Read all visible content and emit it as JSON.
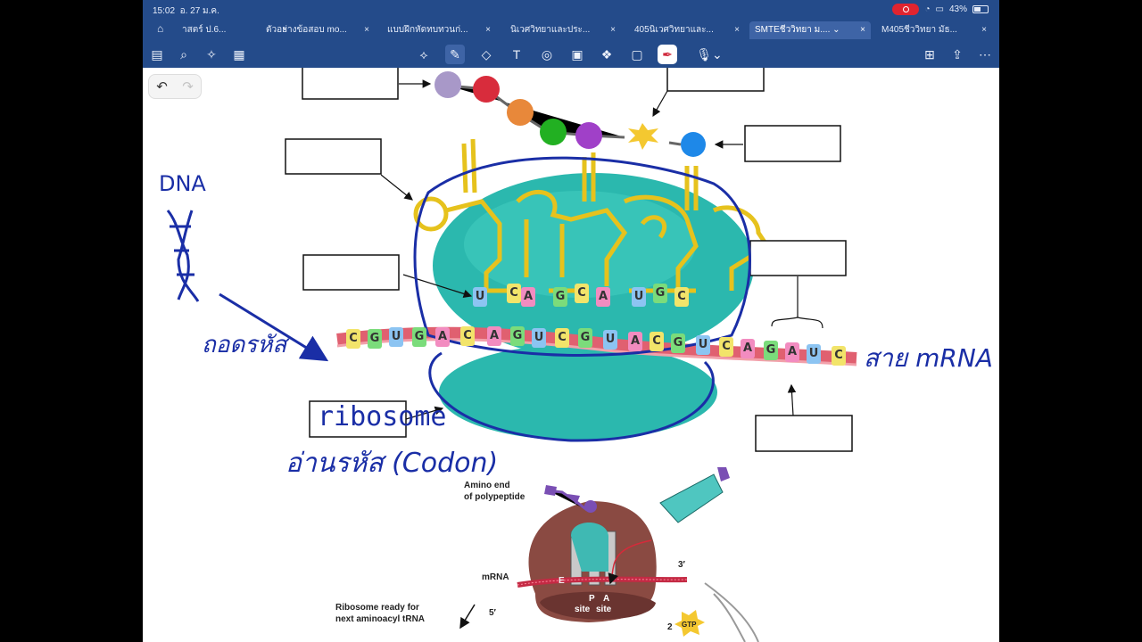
{
  "status": {
    "time": "15:02",
    "date": "อ. 27 ม.ค.",
    "battery": "43%"
  },
  "tabs": [
    {
      "label": "าสตร์ ป.6...",
      "active": false
    },
    {
      "label": "ตัวอย่างข้อสอบ mo...",
      "active": false
    },
    {
      "label": "แบบฝึกหัดทบทวนก่...",
      "active": false
    },
    {
      "label": "นิเวศวิทยาและประ...",
      "active": false
    },
    {
      "label": "405นิเวศวิทยาและ...",
      "active": false
    },
    {
      "label": "SMTEชีววิทยา ม....",
      "active": true
    },
    {
      "label": "M405ชีววิทยา มัธ...",
      "active": false
    }
  ],
  "toolbar_icons": [
    "sidebar-icon",
    "search-icon",
    "sparkle-icon",
    "document-icon",
    "lasso-icon",
    "pencil-icon",
    "eraser-icon",
    "text-box-icon",
    "shapes-icon",
    "image-icon",
    "elements-icon",
    "sticky-note-icon",
    "laser-pen-icon",
    "microphone-icon",
    "add-page-icon",
    "share-icon",
    "more-icon"
  ],
  "colors": {
    "toolbar": "#244b8a",
    "ink": "#1a2ea6",
    "ribosome": "#2bb8ae",
    "mrna": "#e06070"
  },
  "annotations": {
    "dna": "DNA",
    "thod_rahat": "ถอดรหัส",
    "sai_mrna": "สาย mRNA",
    "ribosome": "ribosome",
    "arn_rahat": "อ่านรหัส (Codon)"
  },
  "codons": {
    "mrna": [
      "C",
      "G",
      "U",
      "G",
      "A",
      "C",
      "A",
      "G",
      "U",
      "C",
      "G",
      "U",
      "A",
      "C",
      "G",
      "U",
      "C",
      "A",
      "G",
      "A",
      "U",
      "C"
    ],
    "anticodon1": [
      "U",
      "C",
      "A"
    ],
    "anticodon2": [
      "G",
      "C",
      "A"
    ],
    "anticodon3": [
      "U",
      "G",
      "C"
    ]
  },
  "figure2": {
    "amino_end": "Amino end",
    "of_polypeptide": "of polypeptide",
    "mrna": "mRNA",
    "e": "E",
    "p": "P",
    "a": "A",
    "site1": "site",
    "site2": "site",
    "three_prime": "3′",
    "five_prime": "5′",
    "ready1": "Ribosome ready for",
    "ready2": "next aminoacyl tRNA",
    "step": "2",
    "gtp": "GTP"
  }
}
